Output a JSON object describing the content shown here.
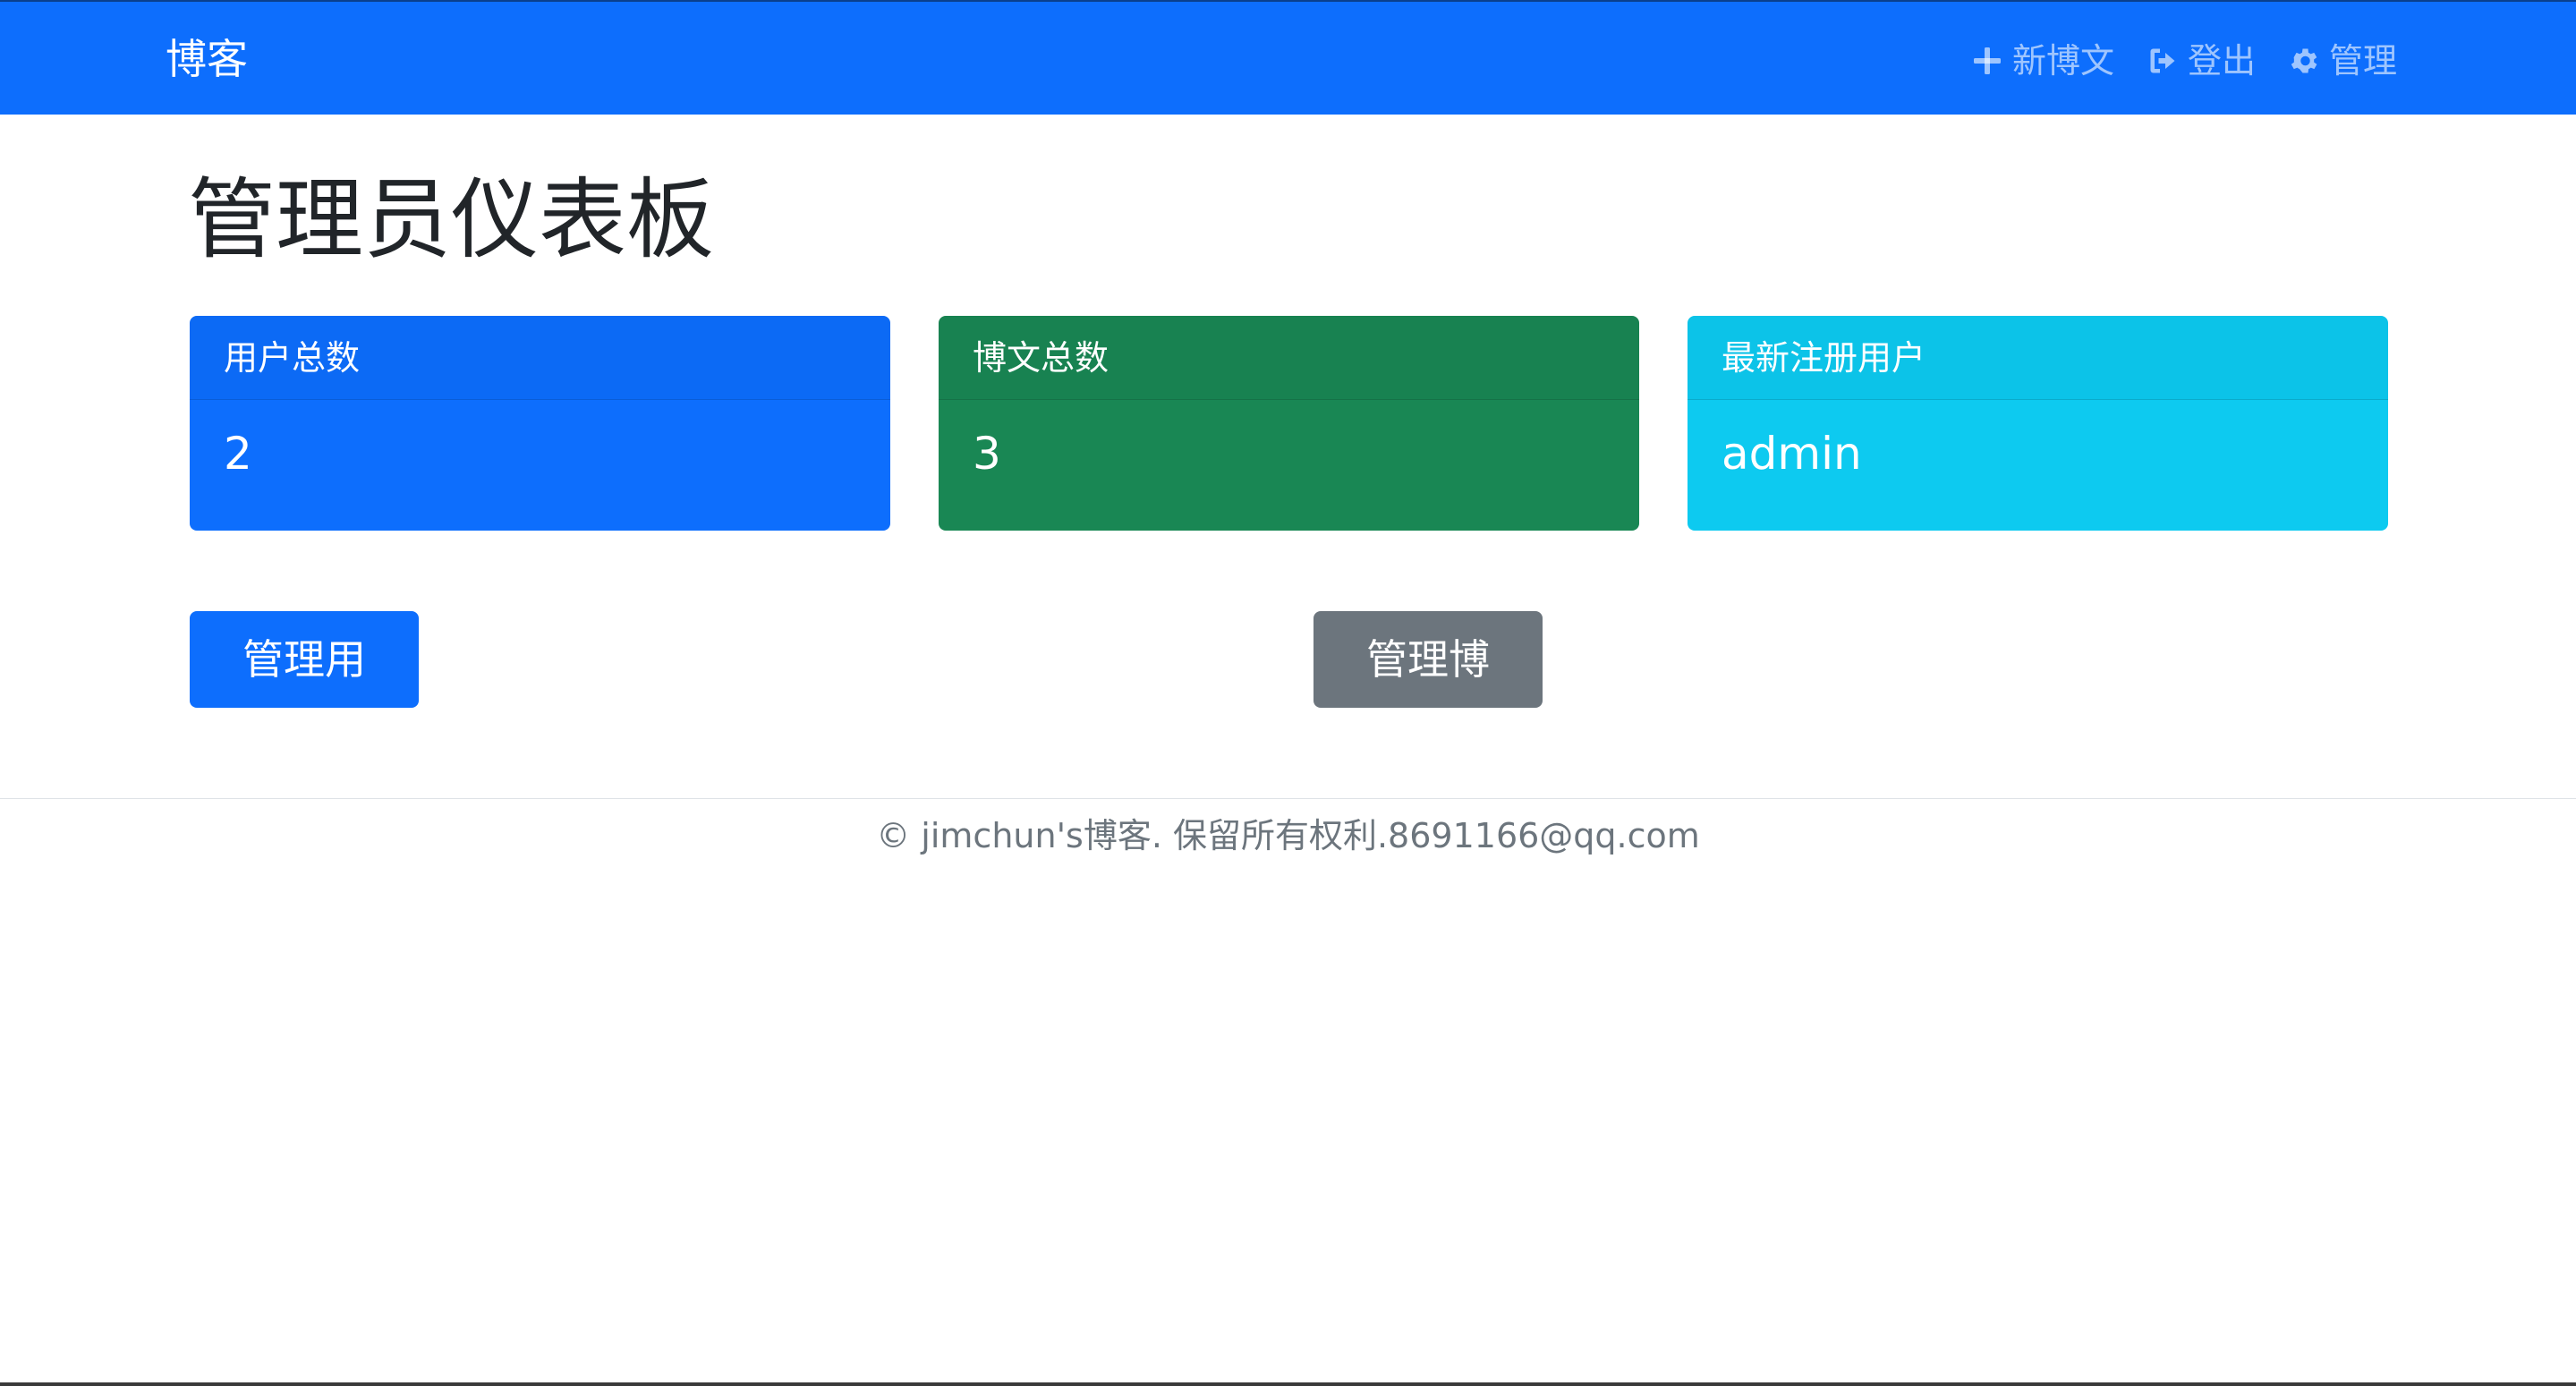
{
  "navbar": {
    "brand": "博客",
    "links": [
      {
        "label": "新博文",
        "icon": "plus-icon"
      },
      {
        "label": "登出",
        "icon": "sign-out-icon"
      },
      {
        "label": "管理",
        "icon": "gear-icon"
      }
    ]
  },
  "main": {
    "title": "管理员仪表板",
    "cards": [
      {
        "header": "用户总数",
        "value": "2",
        "color": "#0d6efd"
      },
      {
        "header": "博文总数",
        "value": "3",
        "color": "#198754"
      },
      {
        "header": "最新注册用户",
        "value": "admin",
        "color": "#0dcaf0"
      }
    ],
    "buttons": {
      "manage_users": "管理用户",
      "manage_posts": "管理博文"
    }
  },
  "footer": {
    "text": "© jimchun's博客. 保留所有权利.8691166@qq.com"
  },
  "colors": {
    "primary": "#0d6efd",
    "success": "#198754",
    "info": "#0dcaf0",
    "secondary": "#6c757d"
  }
}
